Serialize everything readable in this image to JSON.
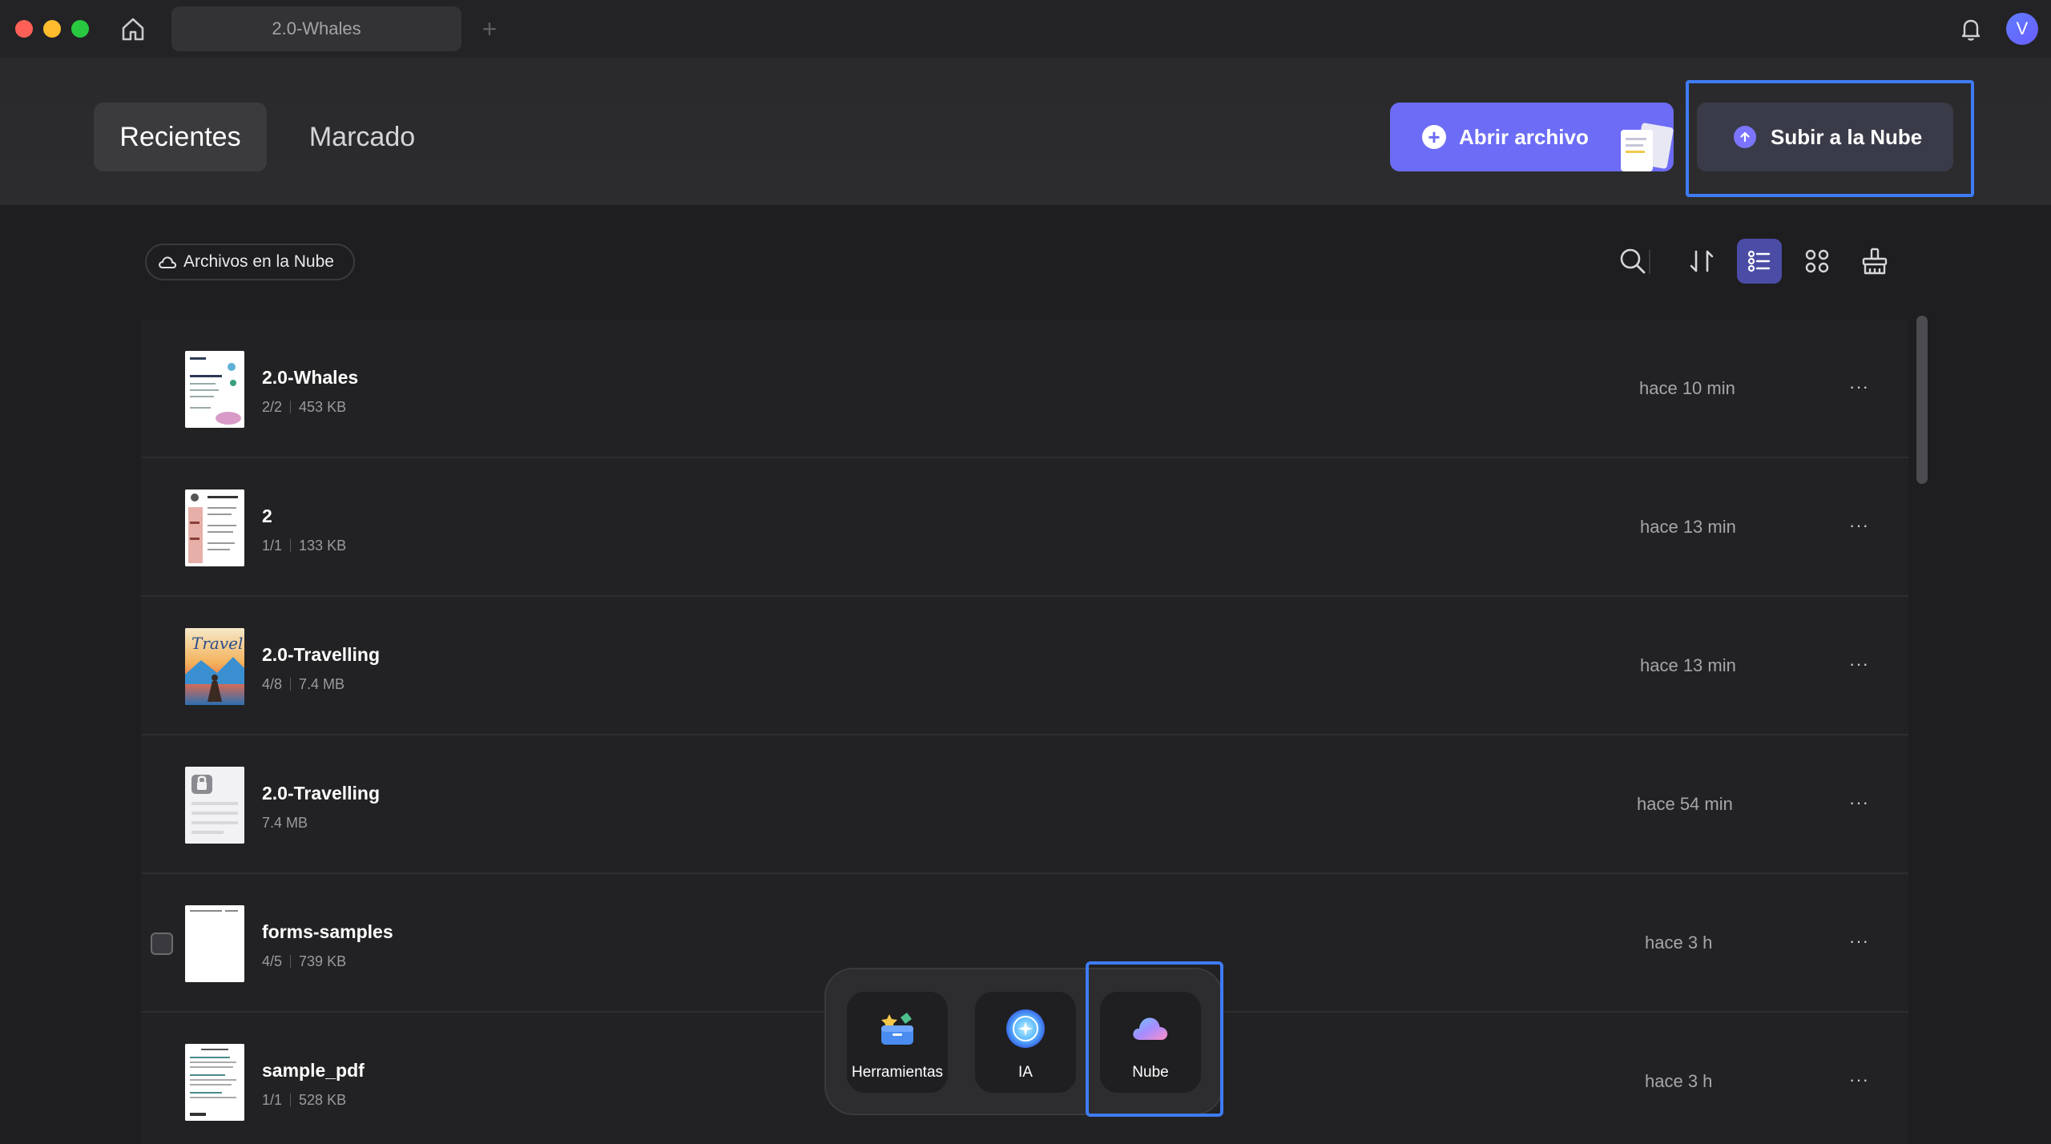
{
  "window": {
    "tab_title": "2.0-Whales",
    "new_tab_symbol": "+",
    "avatar_initial": "V"
  },
  "header": {
    "tabs": [
      {
        "label": "Recientes",
        "active": true
      },
      {
        "label": "Marcado",
        "active": false
      }
    ],
    "open_file_label": "Abrir archivo",
    "upload_label": "Subir a la Nube"
  },
  "toolbar": {
    "cloud_files_label": "Archivos en la Nube",
    "icons": [
      "search-icon",
      "sort-icon",
      "list-view-icon",
      "grid-view-icon",
      "clear-icon"
    ]
  },
  "files": [
    {
      "name": "2.0-Whales",
      "pages": "2/2",
      "size": "453 KB",
      "time": "hace 10 min"
    },
    {
      "name": "2",
      "pages": "1/1",
      "size": "133 KB",
      "time": "hace 13 min"
    },
    {
      "name": "2.0-Travelling",
      "pages": "4/8",
      "size": "7.4 MB",
      "time": "hace 13 min"
    },
    {
      "name": "2.0-Travelling",
      "pages": "",
      "size": "7.4 MB",
      "time": "hace 54 min"
    },
    {
      "name": "forms-samples",
      "pages": "4/5",
      "size": "739 KB",
      "time": "hace 3 h"
    },
    {
      "name": "sample_pdf",
      "pages": "1/1",
      "size": "528 KB",
      "time": "hace 3 h"
    }
  ],
  "more_symbol": "···",
  "dock": {
    "items": [
      {
        "label": "Herramientas"
      },
      {
        "label": "IA"
      },
      {
        "label": "Nube"
      }
    ]
  },
  "colors": {
    "accent": "#6c6cf6",
    "highlight": "#3f7bf5",
    "background": "#1e1e20"
  }
}
